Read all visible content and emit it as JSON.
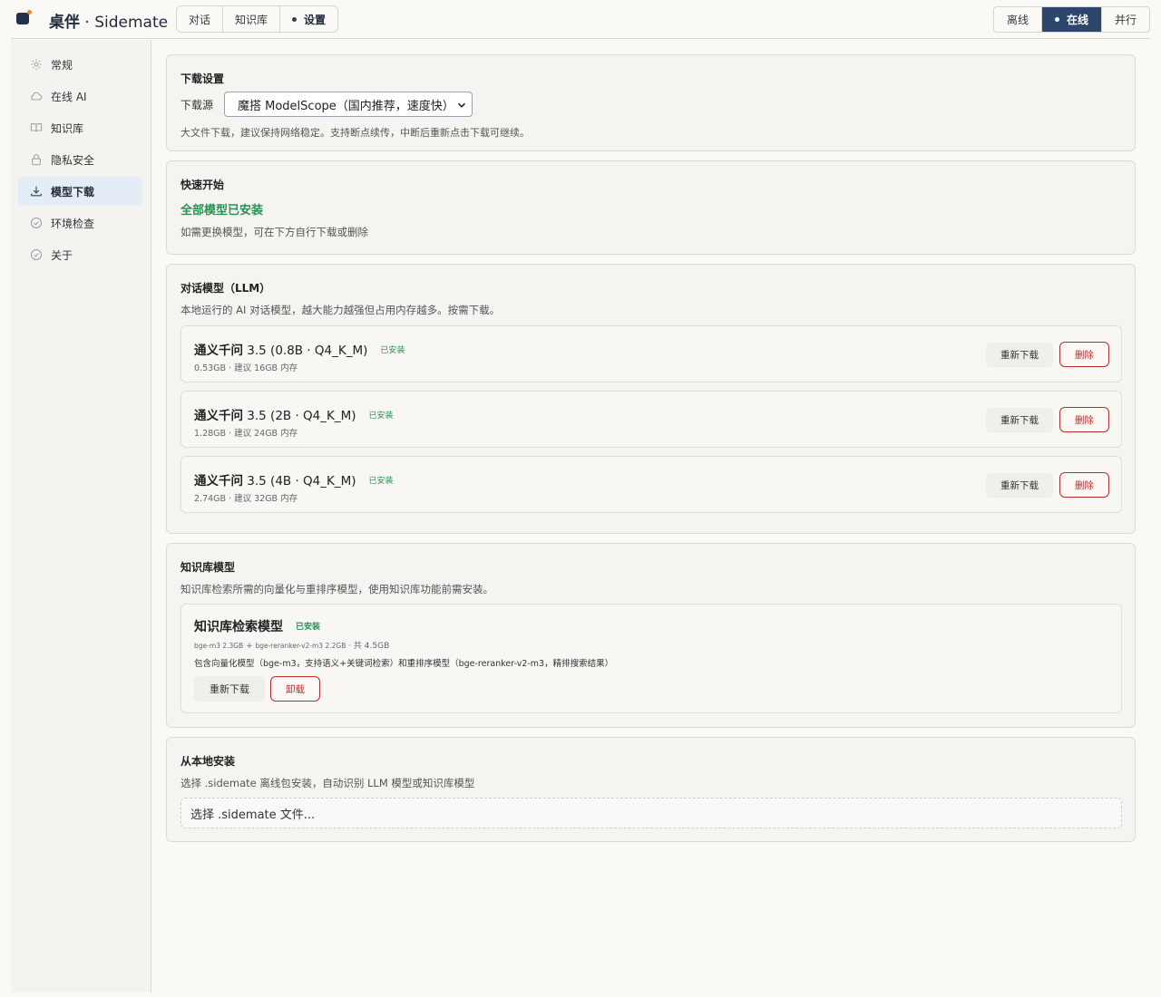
{
  "app": {
    "title_main": "桌伴",
    "title_sep": " · ",
    "title_sub": "Sidemate"
  },
  "nav_tabs": [
    {
      "label": "对话",
      "active": false
    },
    {
      "label": "知识库",
      "active": false
    },
    {
      "label": "设置",
      "active": true
    }
  ],
  "mode_switch": [
    {
      "label": "离线",
      "active": false
    },
    {
      "label": "在线",
      "active": true
    },
    {
      "label": "并行",
      "active": false
    }
  ],
  "sidebar": {
    "items": [
      {
        "label": "常规",
        "icon": "gear-icon",
        "active": false
      },
      {
        "label": "在线 AI",
        "icon": "cloud-icon",
        "active": false
      },
      {
        "label": "知识库",
        "icon": "book-icon",
        "active": false
      },
      {
        "label": "隐私安全",
        "icon": "lock-icon",
        "active": false
      },
      {
        "label": "模型下载",
        "icon": "download-icon",
        "active": true
      },
      {
        "label": "环境检查",
        "icon": "check-circle-icon",
        "active": false
      },
      {
        "label": "关于",
        "icon": "check-circle-icon",
        "active": false
      }
    ]
  },
  "download_settings": {
    "title": "下载设置",
    "source_label": "下载源",
    "source_value": "魔搭 ModelScope（国内推荐，速度快）",
    "note": "大文件下载，建议保持网络稳定。支持断点续传，中断后重新点击下载可继续。"
  },
  "quick_start": {
    "title": "快速开始",
    "status": "全部模型已安装",
    "note": "如需更换模型，可在下方自行下载或删除"
  },
  "llm": {
    "title": "对话模型（LLM）",
    "desc": "本地运行的 AI 对话模型，越大能力越强但占用内存越多。按需下载。",
    "models": [
      {
        "name_bold": "通义千问",
        "name_rest": " 3.5 (0.8B · Q4_K_M)",
        "badge": "已安装",
        "meta": "0.53GB · 建议 16GB 内存",
        "redownload": "重新下载",
        "delete": "删除"
      },
      {
        "name_bold": "通义千问",
        "name_rest": " 3.5 (2B · Q4_K_M)",
        "badge": "已安装",
        "meta": "1.28GB · 建议 24GB 内存",
        "redownload": "重新下载",
        "delete": "删除"
      },
      {
        "name_bold": "通义千问",
        "name_rest": " 3.5 (4B · Q4_K_M)",
        "badge": "已安装",
        "meta": "2.74GB · 建议 32GB 内存",
        "redownload": "重新下载",
        "delete": "删除"
      }
    ]
  },
  "kb_models": {
    "title": "知识库模型",
    "desc": "知识库检索所需的向量化与重排序模型，使用知识库功能前需安装。",
    "item": {
      "name": "知识库检索模型",
      "badge": "已安装",
      "part1": "bge-m3 2.3GB",
      "plus": " + ",
      "part2": "bge-reranker-v2-m3 2.2GB",
      "total": " · 共 4.5GB",
      "detail": "包含向量化模型（bge-m3，支持语义+关键词检索）和重排序模型（bge-reranker-v2-m3，精排搜索结果）",
      "redownload": "重新下载",
      "uninstall": "卸载"
    }
  },
  "local_install": {
    "title": "从本地安装",
    "desc": "选择 .sidemate 离线包安装，自动识别 LLM 模型或知识库模型",
    "picker": "选择 .sidemate 文件..."
  },
  "colors": {
    "accent": "#2d466c",
    "success": "#2a8f52",
    "danger": "#b3322f",
    "background": "#faf9f6"
  }
}
